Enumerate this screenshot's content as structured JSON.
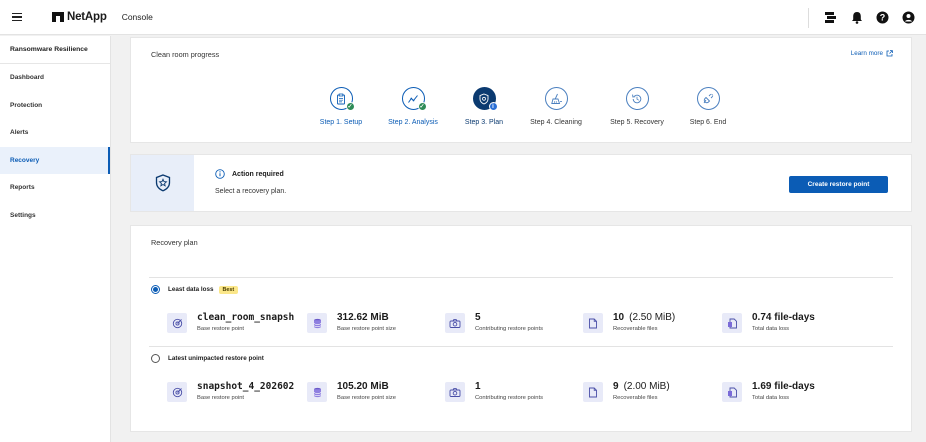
{
  "header": {
    "logo_text": "NetApp",
    "product": "Console",
    "icons": [
      "menu-icon",
      "workloads-icon",
      "bell-icon",
      "help-icon",
      "user-icon"
    ]
  },
  "sidebar": {
    "title": "Ransomware Resilience",
    "items": [
      {
        "label": "Dashboard",
        "active": false
      },
      {
        "label": "Protection",
        "active": false
      },
      {
        "label": "Alerts",
        "active": false
      },
      {
        "label": "Recovery",
        "active": true
      },
      {
        "label": "Reports",
        "active": false
      },
      {
        "label": "Settings",
        "active": false
      }
    ]
  },
  "progress": {
    "title": "Clean room progress",
    "learn_more": "Learn more",
    "steps": [
      {
        "label": "Step 1. Setup",
        "status": "done",
        "icon": "clipboard-icon"
      },
      {
        "label": "Step 2. Analysis",
        "status": "done",
        "icon": "trend-icon"
      },
      {
        "label": "Step 3. Plan",
        "status": "current",
        "icon": "shield-icon"
      },
      {
        "label": "Step 4. Cleaning",
        "status": "future",
        "icon": "broom-icon"
      },
      {
        "label": "Step 5. Recovery",
        "status": "future",
        "icon": "restore-icon"
      },
      {
        "label": "Step 6. End",
        "status": "future",
        "icon": "plug-icon"
      }
    ]
  },
  "action": {
    "title": "Action required",
    "subtitle": "Select a recovery plan.",
    "button": "Create restore point"
  },
  "plan": {
    "title": "Recovery plan",
    "options": [
      {
        "label": "Least data loss",
        "badge": "Best",
        "selected": true,
        "metrics": {
          "base": {
            "value": "clean_room_snapsh",
            "label": "Base restore point"
          },
          "size": {
            "value": "312.62 MiB",
            "label": "Base restore point size"
          },
          "contrib": {
            "value": "5",
            "label": "Contributing restore points"
          },
          "files": {
            "value": "10",
            "sub": "(2.50 MiB)",
            "label": "Recoverable files"
          },
          "loss": {
            "value": "0.74 file-days",
            "label": "Total data loss"
          }
        }
      },
      {
        "label": "Latest unimpacted restore point",
        "badge": "",
        "selected": false,
        "metrics": {
          "base": {
            "value": "snapshot_4_202602",
            "label": "Base restore point"
          },
          "size": {
            "value": "105.20 MiB",
            "label": "Base restore point size"
          },
          "contrib": {
            "value": "1",
            "label": "Contributing restore points"
          },
          "files": {
            "value": "9",
            "sub": "(2.00 MiB)",
            "label": "Recoverable files"
          },
          "loss": {
            "value": "1.69 file-days",
            "label": "Total data loss"
          }
        }
      }
    ]
  },
  "colors": {
    "accent": "#0b5cb5",
    "accent_dark": "#0b3a70",
    "success": "#2e8b57",
    "best_badge": "#fbe78a"
  }
}
